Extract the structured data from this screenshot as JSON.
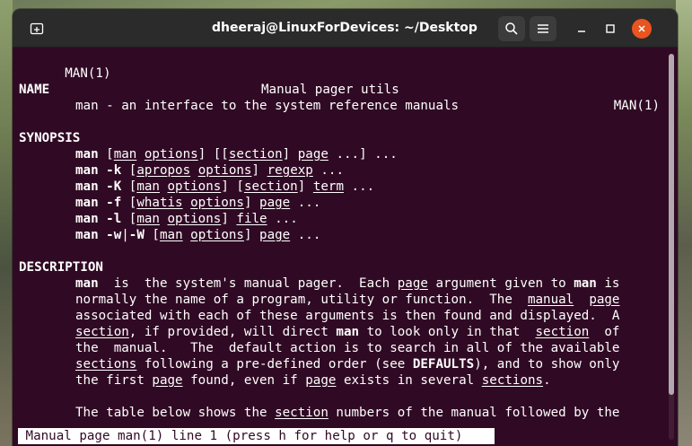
{
  "window": {
    "title": "dheeraj@LinuxForDevices: ~/Desktop",
    "accent_color": "#e95420",
    "terminal_bg": "#300a24",
    "icons": [
      "new-tab-icon",
      "search-icon",
      "hamburger-menu-icon",
      "minimize-icon",
      "maximize-icon",
      "close-icon"
    ]
  },
  "man": {
    "header_left": "MAN(1)",
    "header_center": "Manual pager utils",
    "header_right": "MAN(1)",
    "name_heading": "NAME",
    "name_text": "man - an interface to the system reference manuals",
    "synopsis_heading": "SYNOPSIS",
    "synopsis": [
      [
        {
          "t": "man",
          "s": "b"
        },
        {
          "t": " ["
        },
        {
          "t": "man",
          "s": "u"
        },
        {
          "t": " "
        },
        {
          "t": "options",
          "s": "u"
        },
        {
          "t": "] [["
        },
        {
          "t": "section",
          "s": "u"
        },
        {
          "t": "] "
        },
        {
          "t": "page",
          "s": "u"
        },
        {
          "t": " ...] ..."
        }
      ],
      [
        {
          "t": "man -k",
          "s": "b"
        },
        {
          "t": " ["
        },
        {
          "t": "apropos",
          "s": "u"
        },
        {
          "t": " "
        },
        {
          "t": "options",
          "s": "u"
        },
        {
          "t": "] "
        },
        {
          "t": "regexp",
          "s": "u"
        },
        {
          "t": " ..."
        }
      ],
      [
        {
          "t": "man -K",
          "s": "b"
        },
        {
          "t": " ["
        },
        {
          "t": "man",
          "s": "u"
        },
        {
          "t": " "
        },
        {
          "t": "options",
          "s": "u"
        },
        {
          "t": "] ["
        },
        {
          "t": "section",
          "s": "u"
        },
        {
          "t": "] "
        },
        {
          "t": "term",
          "s": "u"
        },
        {
          "t": " ..."
        }
      ],
      [
        {
          "t": "man -f",
          "s": "b"
        },
        {
          "t": " ["
        },
        {
          "t": "whatis",
          "s": "u"
        },
        {
          "t": " "
        },
        {
          "t": "options",
          "s": "u"
        },
        {
          "t": "] "
        },
        {
          "t": "page",
          "s": "u"
        },
        {
          "t": " ..."
        }
      ],
      [
        {
          "t": "man -l",
          "s": "b"
        },
        {
          "t": " ["
        },
        {
          "t": "man",
          "s": "u"
        },
        {
          "t": " "
        },
        {
          "t": "options",
          "s": "u"
        },
        {
          "t": "] "
        },
        {
          "t": "file",
          "s": "u"
        },
        {
          "t": " ..."
        }
      ],
      [
        {
          "t": "man -w",
          "s": "b"
        },
        {
          "t": "|"
        },
        {
          "t": "-W",
          "s": "b"
        },
        {
          "t": " ["
        },
        {
          "t": "man",
          "s": "u"
        },
        {
          "t": " "
        },
        {
          "t": "options",
          "s": "u"
        },
        {
          "t": "] "
        },
        {
          "t": "page",
          "s": "u"
        },
        {
          "t": " ..."
        }
      ]
    ],
    "description_heading": "DESCRIPTION",
    "description": [
      [
        {
          "t": "man",
          "s": "b"
        },
        {
          "t": "  is  the system's manual pager.  Each "
        },
        {
          "t": "page",
          "s": "u"
        },
        {
          "t": " argument given to "
        },
        {
          "t": "man",
          "s": "b"
        },
        {
          "t": " is"
        }
      ],
      [
        {
          "t": "normally the name of a program, utility or function.  The  "
        },
        {
          "t": "manual",
          "s": "u"
        },
        {
          "t": "  "
        },
        {
          "t": "page",
          "s": "u"
        }
      ],
      [
        {
          "t": "associated with each of these arguments is then found and displayed.  A"
        }
      ],
      [
        {
          "t": "section",
          "s": "u"
        },
        {
          "t": ", if provided, will direct "
        },
        {
          "t": "man",
          "s": "b"
        },
        {
          "t": " to look only in that  "
        },
        {
          "t": "section",
          "s": "u"
        },
        {
          "t": "  of"
        }
      ],
      [
        {
          "t": "the  manual.   The  default action is to search in all of the available"
        }
      ],
      [
        {
          "t": "sections",
          "s": "u"
        },
        {
          "t": " following a pre-defined order (see "
        },
        {
          "t": "DEFAULTS",
          "s": "b"
        },
        {
          "t": "), and to show only"
        }
      ],
      [
        {
          "t": "the first "
        },
        {
          "t": "page",
          "s": "u"
        },
        {
          "t": " found, even if "
        },
        {
          "t": "page",
          "s": "u"
        },
        {
          "t": " exists in several "
        },
        {
          "t": "sections",
          "s": "u"
        },
        {
          "t": "."
        }
      ],
      [
        {
          "t": ""
        }
      ],
      [
        {
          "t": "The table below shows the "
        },
        {
          "t": "section",
          "s": "u"
        },
        {
          "t": " numbers of the manual followed by the"
        }
      ]
    ],
    "status_line": " Manual page man(1) line 1 (press h for help or q to quit)"
  }
}
